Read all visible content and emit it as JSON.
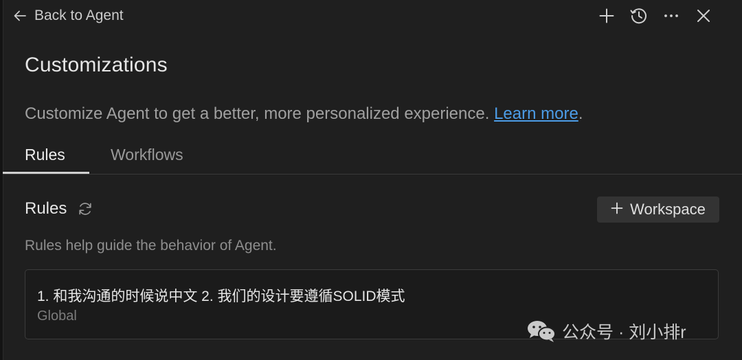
{
  "topbar": {
    "back_label": "Back to Agent",
    "icons": [
      "arrow-left-icon",
      "plus-icon",
      "history-icon",
      "more-icon",
      "close-icon"
    ]
  },
  "page": {
    "title": "Customizations",
    "description": "Customize Agent to get a better, more personalized experience.",
    "learn_more": "Learn more",
    "period": "."
  },
  "tabs": [
    {
      "label": "Rules",
      "active": true
    },
    {
      "label": "Workflows",
      "active": false
    }
  ],
  "rules_section": {
    "title": "Rules",
    "workspace_button": "Workspace",
    "description": "Rules help guide the behavior of Agent.",
    "items": [
      {
        "text": "1. 和我沟通的时候说中文 2. 我们的设计要遵循SOLID模式",
        "scope": "Global"
      }
    ]
  },
  "watermark": {
    "text": "公众号 · 刘小排r"
  },
  "colors": {
    "background": "#1f1f1f",
    "link": "#4c9ce6",
    "button_bg": "#333333",
    "border": "#3c3c3c"
  }
}
